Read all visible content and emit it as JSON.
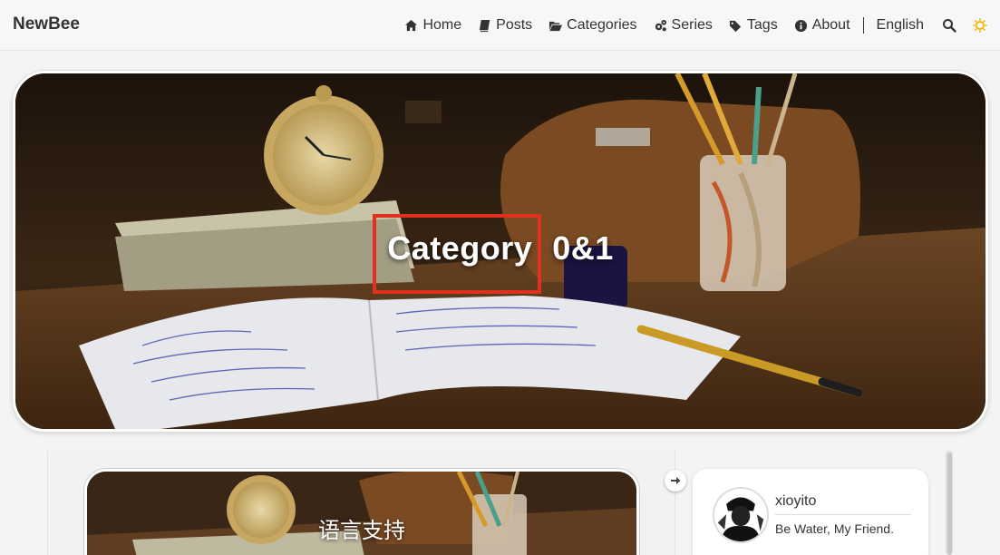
{
  "brand": "NewBee",
  "nav": {
    "items": [
      {
        "label": "Home",
        "icon": "home-icon"
      },
      {
        "label": "Posts",
        "icon": "book-icon"
      },
      {
        "label": "Categories",
        "icon": "folder-open-icon"
      },
      {
        "label": "Series",
        "icon": "cogs-icon"
      },
      {
        "label": "Tags",
        "icon": "tags-icon"
      },
      {
        "label": "About",
        "icon": "info-circle-icon"
      }
    ],
    "language": "English",
    "search_icon": "search-icon",
    "theme_icon": "sun-icon"
  },
  "hero": {
    "title_word": "Category",
    "title_value": "0&1"
  },
  "post": {
    "title": "语言支持",
    "subtitle": ""
  },
  "profile": {
    "name": "xioyito",
    "bio": "Be Water, My Friend."
  },
  "colors": {
    "highlight": "#e0301e",
    "theme_icon": "#f5b800"
  }
}
